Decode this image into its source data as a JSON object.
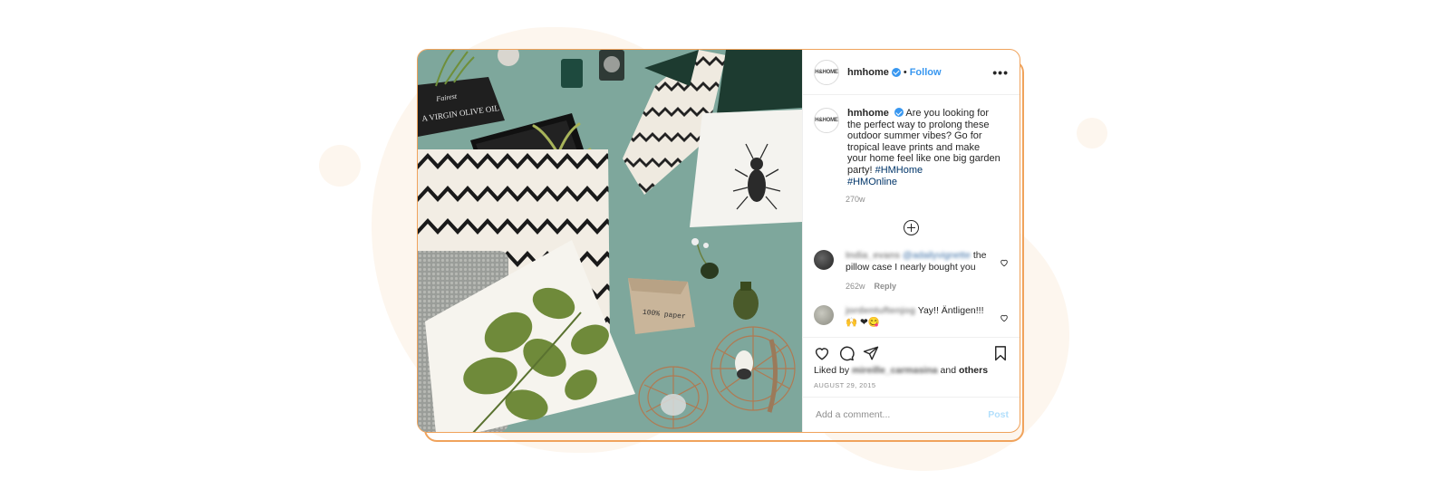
{
  "post": {
    "username": "hmhome",
    "avatar_text": "H&HOME",
    "dot": "•",
    "follow_label": "Follow",
    "more_label": "•••",
    "caption": "Are you looking for the perfect way to prolong these outdoor summer vibes? Go for tropical leave prints and make your home feel like one big garden party!",
    "hashtags": [
      "#HMHome",
      "#HMOnline"
    ],
    "caption_age": "270w"
  },
  "comments": [
    {
      "user": "India_evans",
      "mention": "@adailyvignette",
      "text": "the pillow case I nearly bought you",
      "age": "262w",
      "reply_label": "Reply"
    },
    {
      "user": "jordentuftenjog",
      "text": "Yay!! Äntligen!!!🙌 ❤😋"
    }
  ],
  "likes": {
    "prefix": "Liked by",
    "user": "mireille_carmasina",
    "and": "and",
    "others": "others"
  },
  "date": "AUGUST 29, 2015",
  "add_comment": {
    "placeholder": "Add a comment...",
    "post_label": "Post"
  },
  "photo_text": {
    "crate": "A VIRGIN OLIVE OIL",
    "crate_top": "Fairest",
    "bag": "100% paper"
  },
  "colors": {
    "accent": "#f0a35c",
    "link": "#3897f0",
    "hashtag": "#003569",
    "photo_bg": "#7ea79c"
  }
}
